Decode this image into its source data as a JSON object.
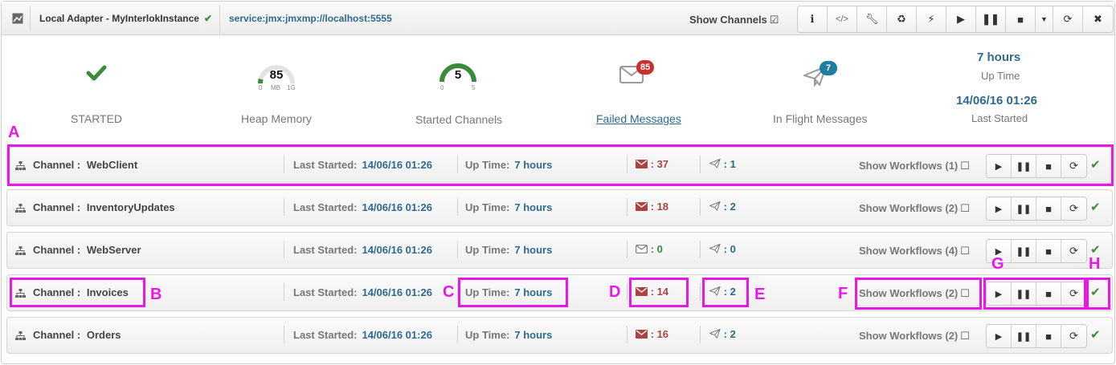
{
  "topbar": {
    "adapter_title": "Local Adapter - MyInterlokInstance",
    "service_url": "service:jmx:jmxmp://localhost:5555",
    "show_channels_label": "Show Channels",
    "buttons": [
      "info-icon",
      "code-icon",
      "wrench-icon",
      "recycle-icon",
      "bolt-icon",
      "play-icon",
      "pause-icon",
      "stop-icon",
      "caret-down-icon",
      "refresh-icon",
      "close-icon"
    ]
  },
  "stats": {
    "status_label": "STARTED",
    "heap": {
      "value": "85",
      "unit": "MB",
      "min": "0",
      "max": "1G",
      "label": "Heap Memory",
      "fraction": 0.085
    },
    "channels": {
      "value": "5",
      "min": "0",
      "max": "5",
      "label": "Started Channels",
      "fraction": 1.0
    },
    "failed": {
      "count": "85",
      "label": "Failed Messages"
    },
    "inflight": {
      "count": "7",
      "label": "In Flight Messages"
    },
    "uptime": {
      "value": "7 hours",
      "label": "Up Time"
    },
    "last_started": {
      "value": "14/06/16 01:26",
      "label": "Last Started"
    }
  },
  "channel_labels": {
    "channel": "Channel :",
    "last_started": "Last Started:",
    "up_time": "Up Time:"
  },
  "channels": [
    {
      "name": "WebClient",
      "last_started": "14/06/16 01:26",
      "up_time": "7 hours",
      "failed": ": 37",
      "failed_style": "filled",
      "inflight": ": 1",
      "workflows": "Show Workflows (1)"
    },
    {
      "name": "InventoryUpdates",
      "last_started": "14/06/16 01:26",
      "up_time": "7 hours",
      "failed": ": 18",
      "failed_style": "filled",
      "inflight": ": 2",
      "workflows": "Show Workflows (2)"
    },
    {
      "name": "WebServer",
      "last_started": "14/06/16 01:26",
      "up_time": "7 hours",
      "failed": ": 0",
      "failed_style": "outline",
      "inflight": ": 0",
      "workflows": "Show Workflows (4)"
    },
    {
      "name": "Invoices",
      "last_started": "14/06/16 01:26",
      "up_time": "7 hours",
      "failed": ": 14",
      "failed_style": "filled",
      "inflight": ": 2",
      "workflows": "Show Workflows (2)"
    },
    {
      "name": "Orders",
      "last_started": "14/06/16 01:26",
      "up_time": "7 hours",
      "failed": ": 16",
      "failed_style": "filled",
      "inflight": ": 2",
      "workflows": "Show Workflows (2)"
    }
  ],
  "annotations": [
    "A",
    "B",
    "C",
    "D",
    "E",
    "F",
    "G",
    "H"
  ],
  "colors": {
    "accent_blue": "#2d6a8e",
    "success_green": "#3c8b3c",
    "danger_red": "#a94442",
    "badge_red": "#c9302c",
    "badge_blue": "#1f7ea1",
    "annotation_magenta": "#e619e6"
  }
}
